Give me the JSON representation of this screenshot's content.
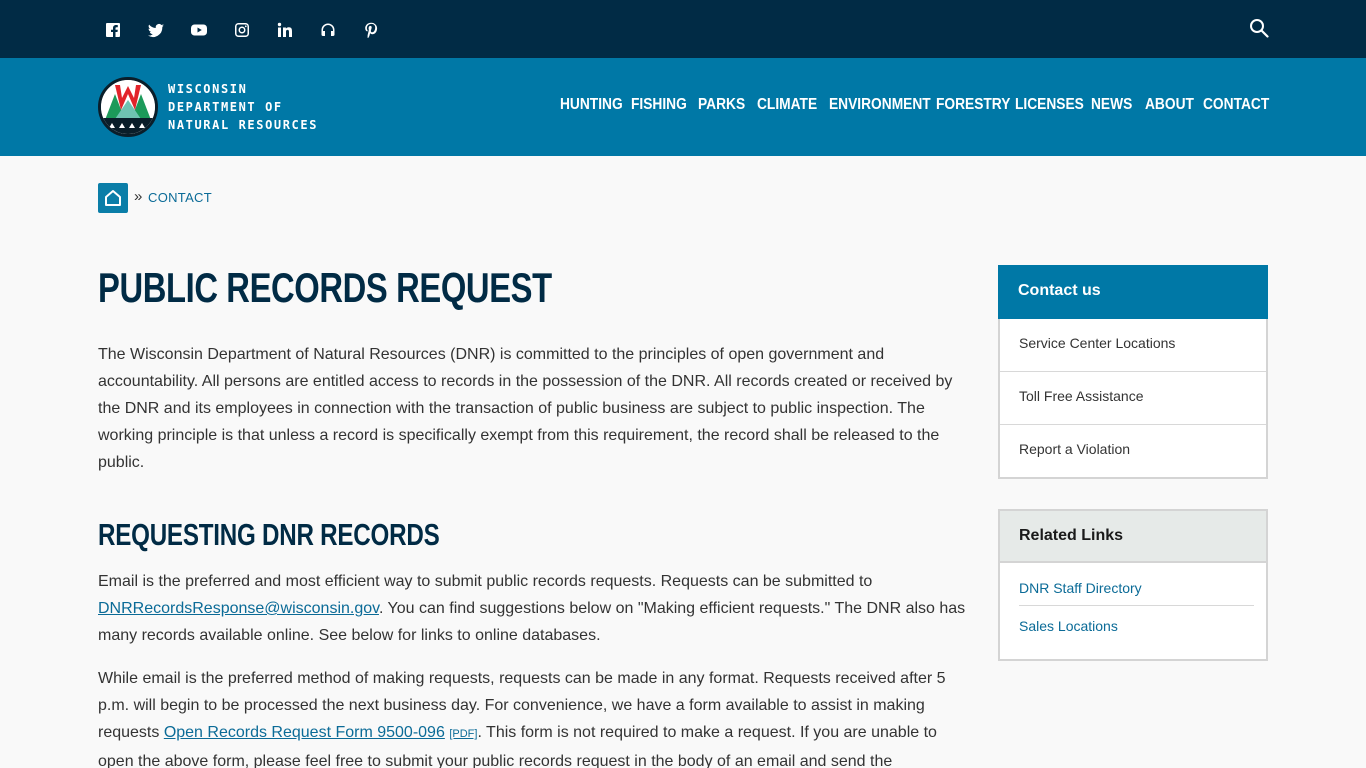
{
  "social": {
    "icons": [
      "facebook-icon",
      "twitter-icon",
      "youtube-icon",
      "instagram-icon",
      "linkedin-icon",
      "podcast-icon",
      "pinterest-icon"
    ]
  },
  "header": {
    "logo_line1": "WISCONSIN",
    "logo_line2": "DEPARTMENT OF",
    "logo_line3": "NATURAL RESOURCES",
    "nav": [
      "HUNTING",
      "FISHING",
      "PARKS",
      "CLIMATE",
      "ENVIRONMENT",
      "FORESTRY",
      "LICENSES",
      "NEWS",
      "ABOUT",
      "CONTACT"
    ]
  },
  "breadcrumb": {
    "separator": "»",
    "current": "CONTACT"
  },
  "main": {
    "title": "PUBLIC RECORDS REQUEST",
    "intro": "The Wisconsin Department of Natural Resources (DNR) is committed to the principles of open government and accountability. All persons are entitled access to records in the possession of the DNR. All records created or received by the DNR and its employees in connection with the transaction of public business are subject to public inspection. The working principle is that unless a record is specifically exempt from this requirement, the record shall be released to the public.",
    "section_title": "REQUESTING DNR RECORDS",
    "email_para": {
      "before": "Email is the preferred and most efficient way to submit public records requests. Requests can be submitted to ",
      "link": "DNRRecordsResponse@wisconsin.gov",
      "after": ". You can find suggestions below on \"Making efficient requests.\" The DNR also has many records available online. See below for links to online databases."
    },
    "format_para": {
      "before": "While email is the preferred method of making requests, requests can be made in any format. Requests received after 5 p.m. will begin to be processed the next business day. For convenience, we have a form available to assist in making requests ",
      "link": "Open Records Request Form 9500-096",
      "pdf": "[PDF]",
      "after": ". This form is not required to make a request. If you are unable to open the above form, please feel free to submit your public records request in the body of an email and send the"
    }
  },
  "sidebar": {
    "contact_title": "Contact us",
    "contact_items": [
      "Service Center Locations",
      "Toll Free Assistance",
      "Report a Violation"
    ],
    "related_title": "Related Links",
    "related_items": [
      "DNR Staff Directory",
      "Sales Locations"
    ]
  },
  "colors": {
    "top_bar": "#012b45",
    "header": "#0078a6",
    "title": "#012b45",
    "link": "#0b6b97"
  }
}
